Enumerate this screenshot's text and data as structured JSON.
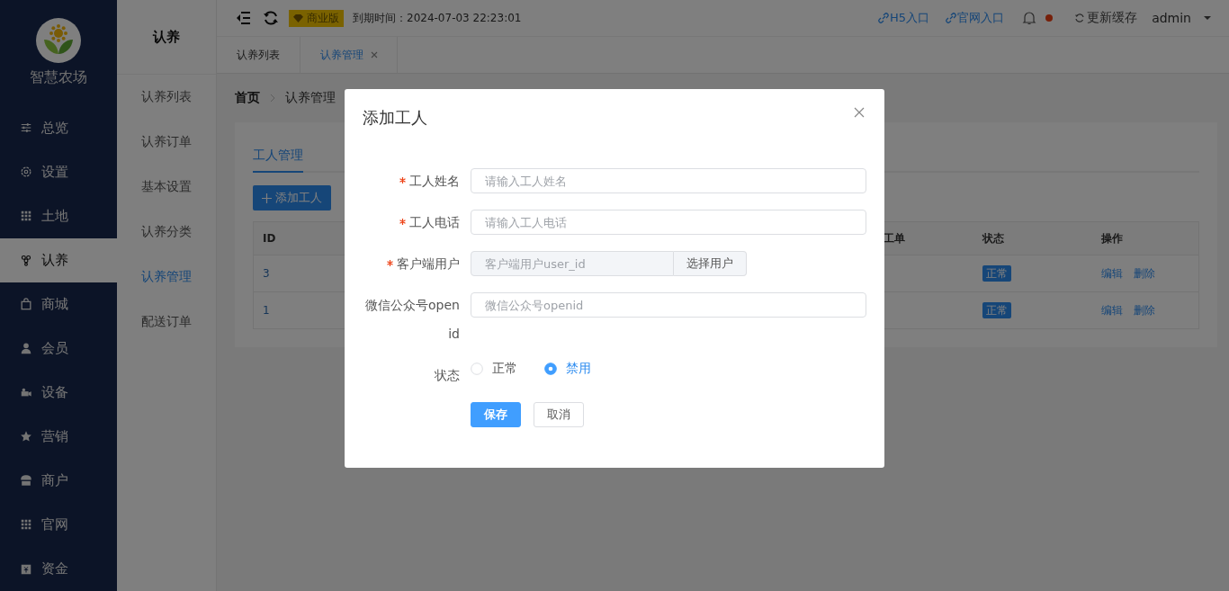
{
  "brand": {
    "name": "智慧农场"
  },
  "sidebar": {
    "items": [
      {
        "label": "总览",
        "selected": false
      },
      {
        "label": "设置",
        "selected": false
      },
      {
        "label": "土地",
        "selected": false
      },
      {
        "label": "认养",
        "selected": true
      },
      {
        "label": "商城",
        "selected": false
      },
      {
        "label": "会员",
        "selected": false
      },
      {
        "label": "设备",
        "selected": false
      },
      {
        "label": "营销",
        "selected": false
      },
      {
        "label": "商户",
        "selected": false
      },
      {
        "label": "官网",
        "selected": false
      },
      {
        "label": "资金",
        "selected": false
      }
    ]
  },
  "submenu": {
    "title": "认养",
    "items": [
      {
        "label": "认养列表",
        "selected": false
      },
      {
        "label": "认养订单",
        "selected": false
      },
      {
        "label": "基本设置",
        "selected": false
      },
      {
        "label": "认养分类",
        "selected": false
      },
      {
        "label": "认养管理",
        "selected": true
      },
      {
        "label": "配送订单",
        "selected": false
      }
    ]
  },
  "header": {
    "edition": "商业版",
    "expiry": "到期时间：2024-07-03 22:23:01",
    "links": [
      "H5入口",
      "官网入口"
    ],
    "notification": true,
    "refresh_cache": "更新缓存",
    "user": "admin"
  },
  "page_tabs": [
    {
      "label": "认养列表",
      "selected": false,
      "closable": false
    },
    {
      "label": "认养管理",
      "selected": true,
      "closable": true
    }
  ],
  "breadcrumb": [
    "首页",
    "认养管理"
  ],
  "card": {
    "tabs": [
      {
        "label": "工人管理",
        "selected": true
      }
    ],
    "add_button": "添加工人",
    "table": {
      "columns": [
        "ID",
        "工单",
        "状态",
        "操作"
      ],
      "rows": [
        {
          "id": "3",
          "status": "正常",
          "actions": [
            "编辑",
            "删除"
          ]
        },
        {
          "id": "1",
          "status": "正常",
          "actions": [
            "编辑",
            "删除"
          ]
        }
      ]
    }
  },
  "dialog": {
    "title": "添加工人",
    "fields": [
      {
        "kind": "text",
        "label": "工人姓名",
        "required": true,
        "placeholder": "请输入工人姓名"
      },
      {
        "kind": "text",
        "label": "工人电话",
        "required": true,
        "placeholder": "请输入工人电话"
      },
      {
        "kind": "picker",
        "label": "客户端用户",
        "required": true,
        "placeholder": "客户端用户user_id",
        "button": "选择用户"
      },
      {
        "kind": "text",
        "label": "微信公众号openid",
        "required": false,
        "placeholder": "微信公众号openid"
      },
      {
        "kind": "radio",
        "label": "状态",
        "required": false,
        "options": [
          {
            "label": "正常",
            "selected": false
          },
          {
            "label": "禁用",
            "selected": true
          }
        ]
      }
    ],
    "buttons": [
      {
        "label": "保存",
        "kind": "primary"
      },
      {
        "label": "取消",
        "kind": "default"
      }
    ]
  }
}
